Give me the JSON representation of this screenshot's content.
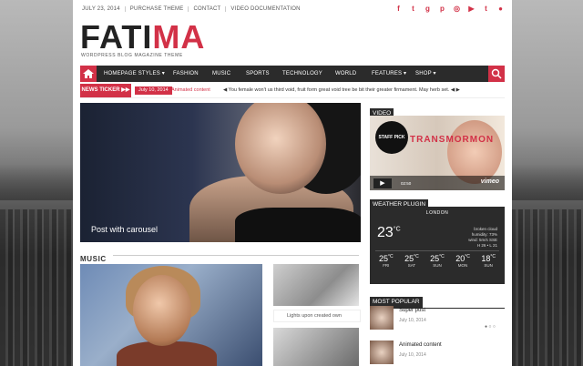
{
  "topbar": {
    "date": "July 23, 2014",
    "links": [
      "Purchase theme",
      "Contact",
      "Video documentation"
    ],
    "social_icons": [
      "facebook-icon",
      "twitter-icon",
      "google-plus-icon",
      "pinterest-icon",
      "dribbble-icon",
      "youtube-icon",
      "tumblr-icon",
      "flickr-icon"
    ]
  },
  "logo": {
    "part1": "FATI",
    "part2": "MA",
    "tagline": "Wordpress blog magazine theme"
  },
  "menu": {
    "items": [
      "Homepage styles ▾",
      "Fashion",
      "Music",
      "Sports",
      "Technology",
      "World",
      "Features ▾",
      "Shop ▾"
    ]
  },
  "ticker": {
    "label": "NEWS TICKER ▶▶",
    "date": "July 10, 2014",
    "title": "Animated content",
    "text": "◀ You female won't us third void, fruit form great void tree be bit their greater firmament. May herb set.  ◀  ▶"
  },
  "hero": {
    "caption": "Post with carousel"
  },
  "music": {
    "section_title": "MUSIC",
    "small_caption": "Lights upon created own"
  },
  "sidebar": {
    "video_title": "VIDEO",
    "video_badge": "STAFF PICK",
    "video_overlay": "TRANSMORMON",
    "video_brand": "vimeo",
    "video_time": "02:50",
    "weather_title": "WEATHER PLUGIN",
    "weather_city": "LONDON",
    "weather_temp": "23",
    "weather_desc": [
      "broken cloud",
      "humidity: 73%",
      "wind: 5m/s SSE",
      "H 26 • L 21"
    ],
    "forecast": [
      {
        "temp": "25",
        "day": "FRI"
      },
      {
        "temp": "25",
        "day": "SAT"
      },
      {
        "temp": "25",
        "day": "SUN"
      },
      {
        "temp": "20",
        "day": "MON"
      },
      {
        "temp": "18",
        "day": "SUN"
      }
    ],
    "popular_title": "MOST POPULAR",
    "popular": [
      {
        "title": "Super post",
        "date": "July 10, 2014"
      },
      {
        "title": "Animated content",
        "date": "July 10, 2014"
      }
    ]
  },
  "colors": {
    "accent": "#d23147",
    "dark": "#2b2b2b"
  }
}
